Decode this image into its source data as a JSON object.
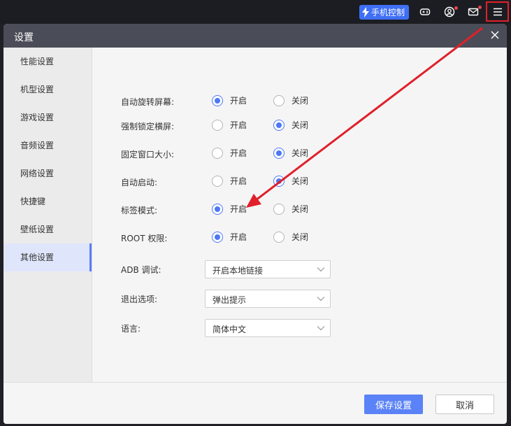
{
  "topbar": {
    "phone_control_label": "手机控制",
    "icons": [
      "gamepad-icon",
      "user-icon",
      "mail-icon",
      "menu-icon"
    ]
  },
  "dialog": {
    "title": "设置",
    "sidebar": {
      "items": [
        {
          "label": "性能设置",
          "active": false
        },
        {
          "label": "机型设置",
          "active": false
        },
        {
          "label": "游戏设置",
          "active": false
        },
        {
          "label": "音频设置",
          "active": false
        },
        {
          "label": "网络设置",
          "active": false
        },
        {
          "label": "快捷键",
          "active": false
        },
        {
          "label": "壁纸设置",
          "active": false
        },
        {
          "label": "其他设置",
          "active": true
        }
      ]
    },
    "radio_rows": [
      {
        "label": "自动旋转屏幕:",
        "on_label": "开启",
        "off_label": "关闭",
        "selected": "on"
      },
      {
        "label": "强制锁定横屏:",
        "on_label": "开启",
        "off_label": "关闭",
        "selected": "off"
      },
      {
        "label": "固定窗口大小:",
        "on_label": "开启",
        "off_label": "关闭",
        "selected": "off"
      },
      {
        "label": "自动启动:",
        "on_label": "开启",
        "off_label": "关闭",
        "selected": "off"
      },
      {
        "label": "标签模式:",
        "on_label": "开启",
        "off_label": "关闭",
        "selected": "on"
      },
      {
        "label": "ROOT 权限:",
        "on_label": "开启",
        "off_label": "关闭",
        "selected": "on"
      }
    ],
    "select_rows": [
      {
        "label": "ADB 调试:",
        "value": "开启本地链接"
      },
      {
        "label": "退出选项:",
        "value": "弹出提示"
      },
      {
        "label": "语言:",
        "value": "简体中文"
      }
    ],
    "save_label": "保存设置",
    "cancel_label": "取消"
  },
  "colors": {
    "accent": "#4d78f5",
    "annotation_red": "#e0202a",
    "header": "#4a4d57"
  }
}
